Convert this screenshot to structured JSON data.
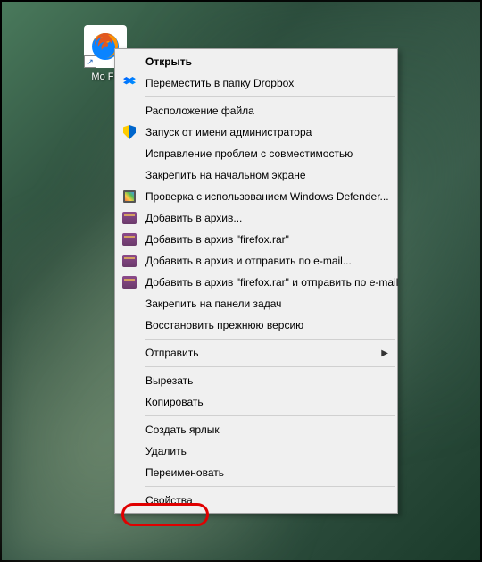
{
  "desktop_icon": {
    "label": "Mo\nFir",
    "aria": "Mozilla Firefox"
  },
  "menu": {
    "open": "Открыть",
    "dropbox": "Переместить в папку Dropbox",
    "file_location": "Расположение файла",
    "run_as_admin": "Запуск от имени администратора",
    "compat_troubleshoot": "Исправление проблем с совместимостью",
    "pin_start": "Закрепить на начальном экране",
    "defender": "Проверка с использованием Windows Defender...",
    "add_archive": "Добавить в архив...",
    "add_firefox_rar": "Добавить в архив \"firefox.rar\"",
    "add_email": "Добавить в архив и отправить по e-mail...",
    "add_firefox_email": "Добавить в архив \"firefox.rar\" и отправить по e-mail",
    "pin_taskbar": "Закрепить на панели задач",
    "restore_prev": "Восстановить прежнюю версию",
    "send_to": "Отправить",
    "cut": "Вырезать",
    "copy": "Копировать",
    "create_shortcut": "Создать ярлык",
    "delete": "Удалить",
    "rename": "Переименовать",
    "properties": "Свойства"
  }
}
